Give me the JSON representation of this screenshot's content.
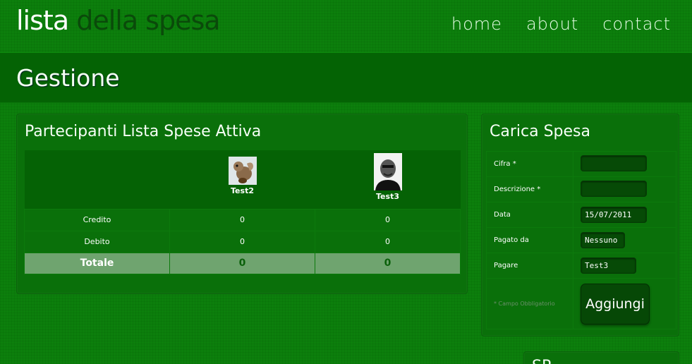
{
  "logo": {
    "word1": "lista",
    "word2": "della spesa"
  },
  "nav": [
    "home",
    "about",
    "contact"
  ],
  "page_title": "Gestione",
  "participants": {
    "title": "Partecipanti Lista Spese Attiva",
    "users": [
      {
        "name": "Test2",
        "avatar": "squirrel-avatar-icon"
      },
      {
        "name": "Test3",
        "avatar": "person-avatar-icon"
      }
    ],
    "rows": [
      {
        "label": "Credito",
        "values": [
          "0",
          "0"
        ]
      },
      {
        "label": "Debito",
        "values": [
          "0",
          "0"
        ]
      }
    ],
    "total": {
      "label": "Totale",
      "values": [
        "0",
        "0"
      ]
    }
  },
  "form": {
    "title": "Carica Spesa",
    "fields": [
      {
        "label": "Cifra *",
        "value": ""
      },
      {
        "label": "Descrizione *",
        "value": ""
      },
      {
        "label": "Data",
        "value": "15/07/2011"
      },
      {
        "label": "Pagato da",
        "value": "Nessuno"
      },
      {
        "label": "Pagare",
        "value": "Test3"
      }
    ],
    "required_note": "* Campo Obbligatorio",
    "submit": "Aggiungi"
  },
  "next_panel_title": "SP..."
}
